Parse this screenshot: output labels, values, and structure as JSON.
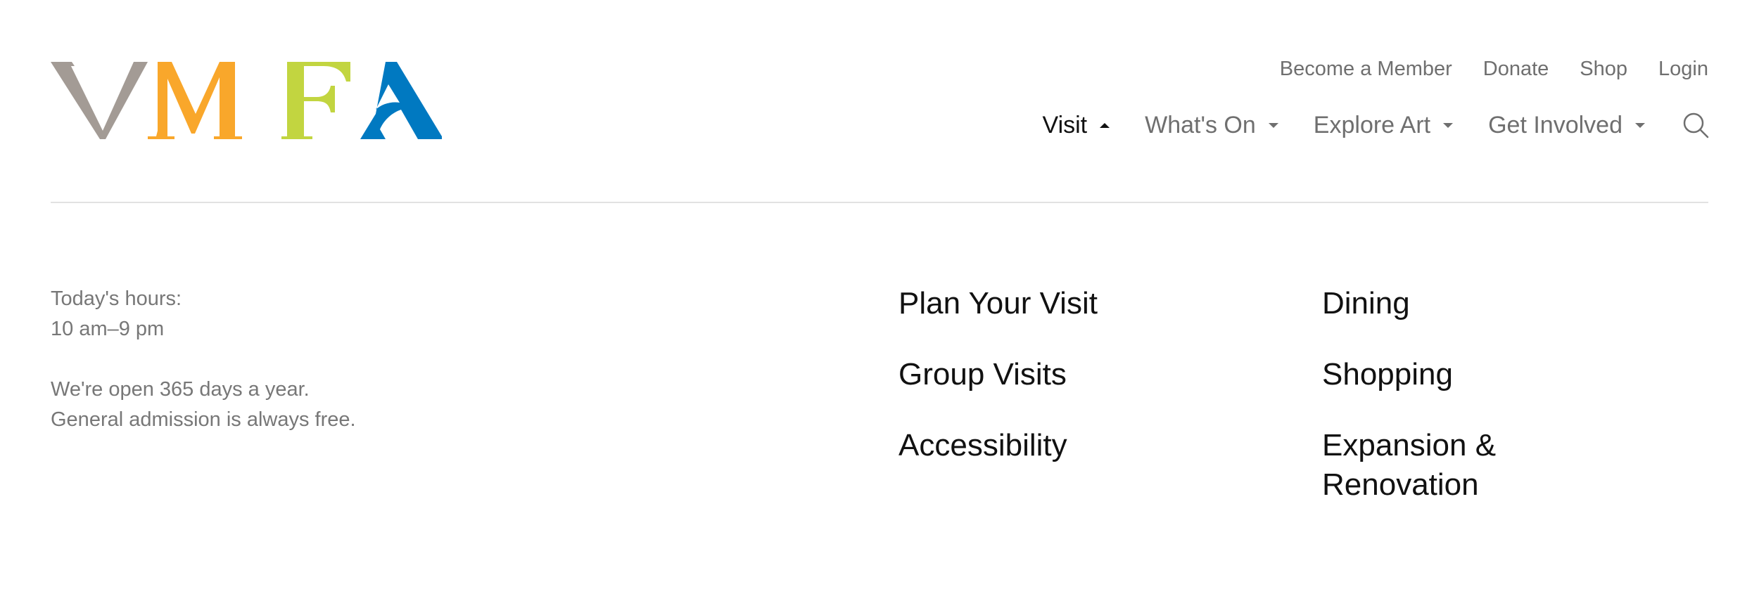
{
  "brand": {
    "logo_text": "VMFA",
    "logo_colors": [
      "#a39b95",
      "#f9a72b",
      "#c2d540",
      "#0079c1"
    ]
  },
  "utility_nav": {
    "items": [
      {
        "label": "Become a Member"
      },
      {
        "label": "Donate"
      },
      {
        "label": "Shop"
      },
      {
        "label": "Login"
      }
    ]
  },
  "main_nav": {
    "items": [
      {
        "label": "Visit",
        "expanded": true
      },
      {
        "label": "What's On",
        "expanded": false
      },
      {
        "label": "Explore Art",
        "expanded": false
      },
      {
        "label": "Get Involved",
        "expanded": false
      }
    ],
    "search_icon": "search-icon"
  },
  "mega_menu": {
    "hours_label": "Today's hours:",
    "hours_value": "10 am–9 pm",
    "info_line1": "We're open 365 days a year.",
    "info_line2": "General admission is always free.",
    "column1": [
      {
        "label": "Plan Your Visit"
      },
      {
        "label": "Group Visits"
      },
      {
        "label": "Accessibility"
      }
    ],
    "column2": [
      {
        "label": "Dining"
      },
      {
        "label": "Shopping"
      },
      {
        "label": "Expansion & Renovation"
      }
    ]
  },
  "colors": {
    "text_primary": "#111111",
    "text_muted": "#6f6f6f",
    "divider": "#e2e2e2"
  }
}
